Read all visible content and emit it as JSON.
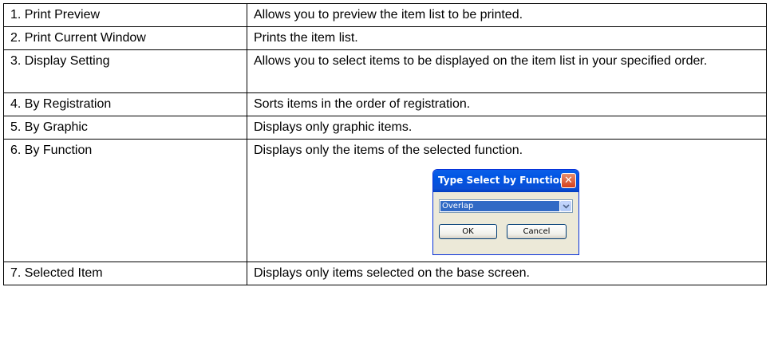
{
  "rows": [
    {
      "item": "1. Print Preview",
      "description": "Allows you to preview the item list to be printed."
    },
    {
      "item": "2. Print Current Window",
      "description": "Prints the item list."
    },
    {
      "item": "3. Display Setting",
      "description": "Allows you to select items to be displayed on the item list in your specified order."
    },
    {
      "item": "4. By Registration",
      "description": "Sorts items in the order of registration."
    },
    {
      "item": "5. By Graphic",
      "description": "Displays only graphic items."
    },
    {
      "item": "6. By Function",
      "description": "Displays only the items of the selected function."
    },
    {
      "item": "7. Selected Item",
      "description": "Displays only items selected on the base screen."
    }
  ],
  "dialog": {
    "title": "Type Select by Function",
    "close_icon": "close-x-icon",
    "combo_value": "Overlap",
    "combo_icon": "chevron-down-icon",
    "ok_label": "OK",
    "cancel_label": "Cancel"
  }
}
